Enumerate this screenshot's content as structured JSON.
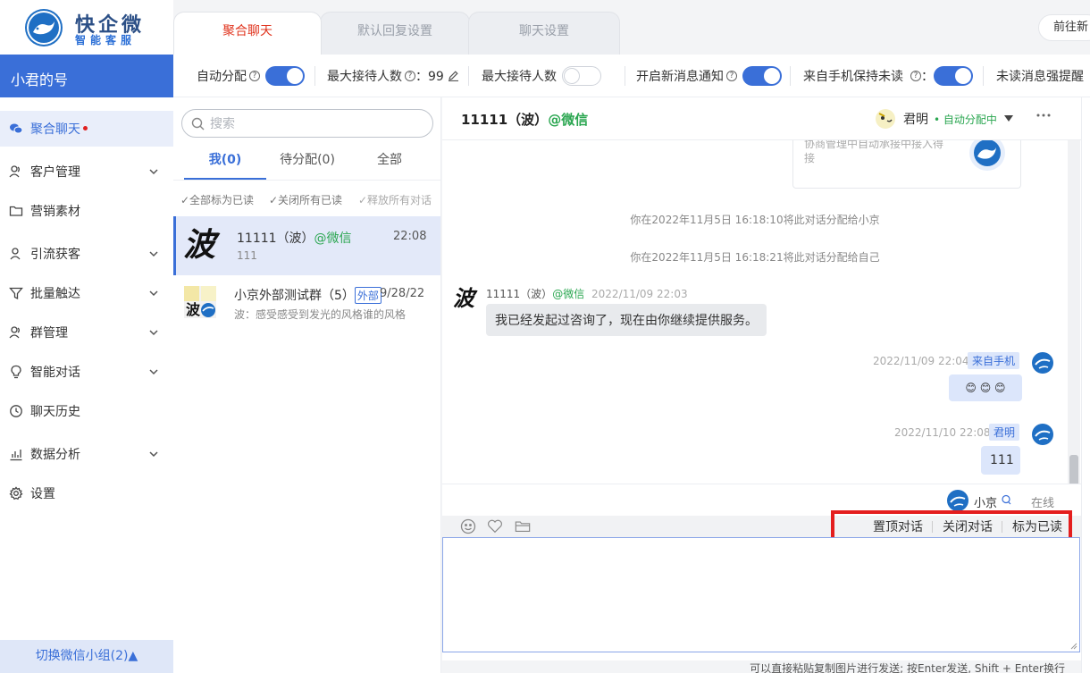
{
  "brand": {
    "name": "快企微",
    "subtitle": "智能客服"
  },
  "account": {
    "name": "小君的号"
  },
  "sidebar": {
    "items": [
      {
        "label": "聚合聊天",
        "icon": "wechat-icon",
        "active": true,
        "dot": true
      },
      {
        "label": "客户管理",
        "icon": "users-icon",
        "expandable": true
      },
      {
        "label": "营销素材",
        "icon": "folder-icon"
      },
      {
        "label": "引流获客",
        "icon": "user-plus-icon",
        "expandable": true
      },
      {
        "label": "批量触达",
        "icon": "funnel-icon",
        "expandable": true
      },
      {
        "label": "群管理",
        "icon": "group-icon",
        "expandable": true
      },
      {
        "label": "智能对话",
        "icon": "bulb-icon",
        "expandable": true
      },
      {
        "label": "聊天历史",
        "icon": "clock-icon"
      },
      {
        "label": "数据分析",
        "icon": "bar-chart-icon",
        "expandable": true
      },
      {
        "label": "设置",
        "icon": "gear-icon"
      }
    ],
    "switch_group": "切换微信小组(2)▲"
  },
  "tabs": [
    {
      "label": "聚合聊天",
      "active": true
    },
    {
      "label": "默认回复设置"
    },
    {
      "label": "聊天设置"
    }
  ],
  "goto_button": "前往新",
  "settings": {
    "auto_assign": {
      "label": "自动分配",
      "on": true
    },
    "max_reception": {
      "label": "最大接待人数",
      "value": "：99"
    },
    "max_reception_toggle": {
      "label": "最大接待人数",
      "on": false
    },
    "new_msg_notify": {
      "label": "开启新消息通知",
      "on": true
    },
    "keep_unread": {
      "label": "来自手机保持未读",
      "colon": "：",
      "on": true
    },
    "unread_reminder": {
      "label": "未读消息强提醒"
    }
  },
  "conv_list": {
    "search_placeholder": "搜索",
    "tabs": [
      {
        "label": "我(0)",
        "active": true
      },
      {
        "label": "待分配(0)"
      },
      {
        "label": "全部"
      }
    ],
    "bulk_actions": [
      "✓全部标为已读",
      "✓关闭所有已读",
      "✓释放所有对话"
    ],
    "items": [
      {
        "name": "11111（波）",
        "source": "@微信",
        "time": "22:08",
        "snippet": "111",
        "active": true
      },
      {
        "name": "小京外部测试群（5）",
        "tag": "外部",
        "time": "9/28/22",
        "snippet": "波：感受感受到发光的风格谁的风格"
      }
    ]
  },
  "chat": {
    "title": "11111（波）",
    "title_source": "@微信",
    "agent_name": "君明",
    "agent_status": "• 自动分配中",
    "card_text": "协商管理中自动承接中接入得接",
    "system_messages": [
      "你在2022年11月5日 16:18:10将此对话分配给小京",
      "你在2022年11月5日 16:18:21将此对话分配给自己"
    ],
    "messages": [
      {
        "side": "left",
        "sender": "11111（波）",
        "source": "@微信",
        "time": "2022/11/09 22:03",
        "text": "我已经发起过咨询了，现在由你继续提供服务。"
      },
      {
        "side": "right",
        "time": "2022/11/09 22:04",
        "tag": "来自手机",
        "text": "😊 😊 😊"
      },
      {
        "side": "right",
        "time": "2022/11/10 22:08",
        "tag": "君明",
        "text": "111"
      }
    ],
    "status_user": "小京",
    "status_text": "在线",
    "actions": [
      "置顶对话",
      "关闭对话",
      "标为已读"
    ],
    "footer_hint": "可以直接粘贴复制图片进行发送; 按Enter发送, Shift + Enter换行"
  }
}
